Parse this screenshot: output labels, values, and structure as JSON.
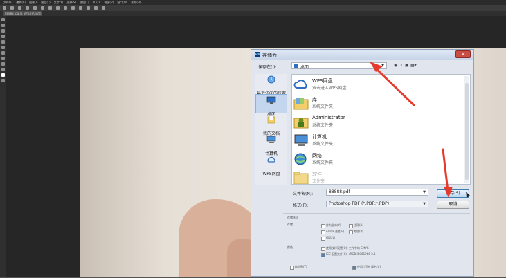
{
  "menubar": {
    "items": [
      "文件(F)",
      "编辑(E)",
      "图像(I)",
      "图层(L)",
      "文字(Y)",
      "选择(S)",
      "滤镜(T)",
      "3D(D)",
      "视图(V)",
      "窗口(W)",
      "帮助(H)"
    ]
  },
  "document_tab": {
    "label": "88888.jpg @ 50% (RGB/8)"
  },
  "dialog": {
    "title": "存储为",
    "save_in_label": "保存在(I):",
    "save_in_value": "桌面",
    "places": [
      {
        "label": "最近访问的位置",
        "icon": "recent-icon"
      },
      {
        "label": "桌面",
        "icon": "desktop-icon"
      },
      {
        "label": "我的文档",
        "icon": "documents-icon"
      },
      {
        "label": "计算机",
        "icon": "computer-icon"
      },
      {
        "label": "WPS网盘",
        "icon": "cloud-icon"
      }
    ],
    "files": [
      {
        "name": "WPS网盘",
        "sub": "双击进入WPS网盘",
        "icon": "cloud-icon"
      },
      {
        "name": "库",
        "sub": "系统文件夹",
        "icon": "library-icon"
      },
      {
        "name": "Administrator",
        "sub": "系统文件夹",
        "icon": "user-folder-icon"
      },
      {
        "name": "计算机",
        "sub": "系统文件夹",
        "icon": "computer-icon"
      },
      {
        "name": "网络",
        "sub": "系统文件夹",
        "icon": "network-icon"
      },
      {
        "name": "软件",
        "sub": "文件夹",
        "icon": "folder-icon"
      }
    ],
    "filename_label": "文件名(N):",
    "filename_value": "88888.pdf",
    "format_label": "格式(F):",
    "format_value": "Photoshop PDF (*.PDF;*.PDP)",
    "save_button": "保存(S)",
    "cancel_button": "取消",
    "options": {
      "section_label": "存储选项",
      "store_label": "存储:",
      "as_copy": "作为副本(Y)",
      "notes": "注释(N)",
      "alpha": "Alpha 通道(E)",
      "spot": "专色(P)",
      "layers": "图层(L)",
      "color_label": "颜色:",
      "proof": "使用校样设置(O): 工作中的 CMYK",
      "icc": "ICC 配置文件(C): sRGB IEC61966-2.1",
      "thumbnail": "缩览图(T)",
      "lowercase": "使用小写扩展名(U)"
    }
  },
  "colors": {
    "annotation_arrow": "#e53b2c",
    "dialog_bg": "#e1e6ee",
    "selected_place": "#c4d6ee"
  }
}
